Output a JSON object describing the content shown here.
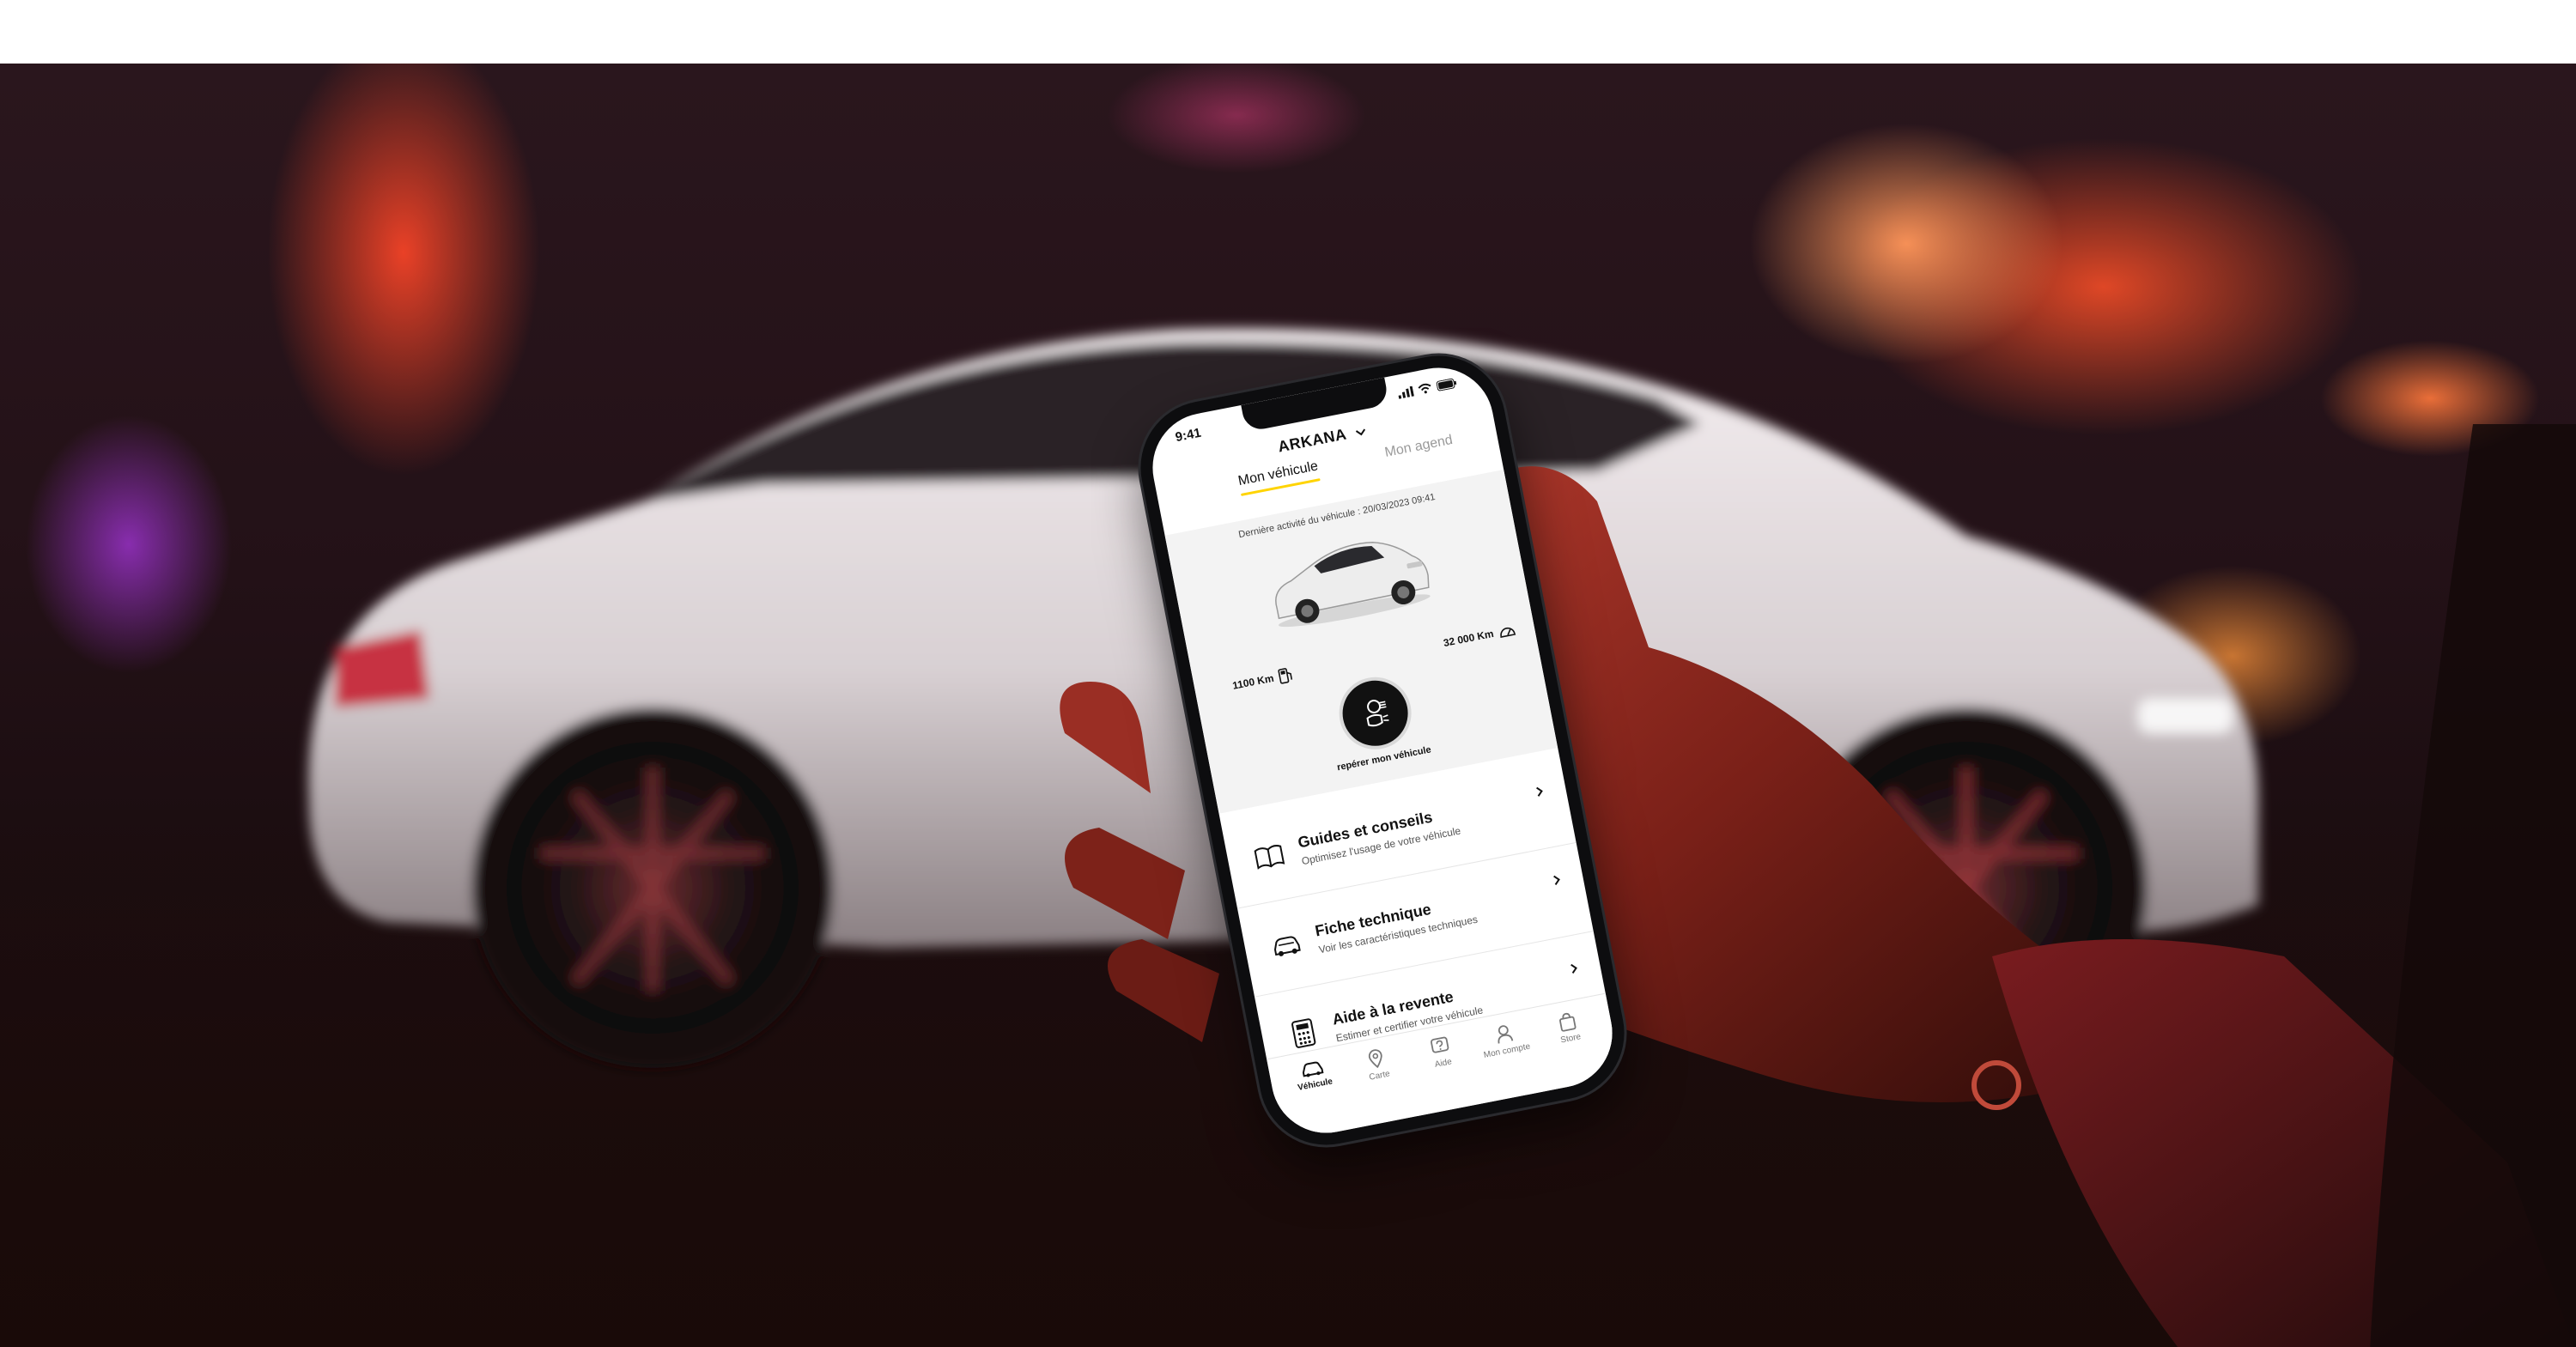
{
  "app": {
    "status_time": "9:41",
    "vehicle_name": "ARKANA",
    "tabs": [
      {
        "label": "Mon véhicule",
        "active": true
      },
      {
        "label": "Mon agend",
        "active": false
      }
    ],
    "last_activity": "Dernière activité du véhicule : 20/03/2023 09:41",
    "range": "1100 Km",
    "odometer": "32 000 Km",
    "locate_label": "repérer mon véhicule",
    "menu": [
      {
        "title": "Guides et conseils",
        "subtitle": "Optimisez l'usage de votre véhicule",
        "icon": "book-icon"
      },
      {
        "title": "Fiche technique",
        "subtitle": "Voir les caractéristiques techniques",
        "icon": "car-spec-icon"
      },
      {
        "title": "Aide à la revente",
        "subtitle": "Estimer et certifier votre véhicule",
        "icon": "calculator-icon"
      }
    ],
    "bottom_nav": [
      {
        "label": "Véhicule",
        "active": true
      },
      {
        "label": "Carte",
        "active": false
      },
      {
        "label": "Aide",
        "active": false
      },
      {
        "label": "Mon compte",
        "active": false
      },
      {
        "label": "Store",
        "active": false
      }
    ],
    "accent_color": "#ffd400"
  }
}
